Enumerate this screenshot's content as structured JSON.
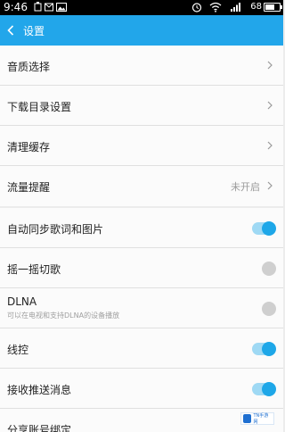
{
  "status_bar": {
    "time": "9:46",
    "battery_text": "68",
    "battery_level": 0.68,
    "icons": [
      "notification-icon",
      "message-icon",
      "image-icon",
      "alarm-icon",
      "wifi-icon",
      "signal-icon",
      "battery-icon"
    ]
  },
  "header": {
    "title": "设置",
    "back_icon": "back-arrow-icon",
    "bg_color": "#22a6ea"
  },
  "settings": [
    {
      "label": "音质选择",
      "type": "nav"
    },
    {
      "label": "下载目录设置",
      "type": "nav"
    },
    {
      "label": "清理缓存",
      "type": "nav"
    },
    {
      "label": "流量提醒",
      "type": "nav",
      "value": "未开启"
    },
    {
      "label": "自动同步歌词和图片",
      "type": "toggle",
      "on": true
    },
    {
      "label": "摇一摇切歌",
      "type": "toggle",
      "on": false
    },
    {
      "label": "DLNA",
      "type": "toggle",
      "on": false,
      "sub": "可以在电视和支持DLNA的设备播放"
    },
    {
      "label": "线控",
      "type": "toggle",
      "on": true
    },
    {
      "label": "接收推送消息",
      "type": "toggle",
      "on": true
    },
    {
      "label": "分享账号绑定",
      "type": "nav"
    }
  ],
  "accent_color": "#1ea7e8",
  "watermark": {
    "text": "TN手游网"
  }
}
